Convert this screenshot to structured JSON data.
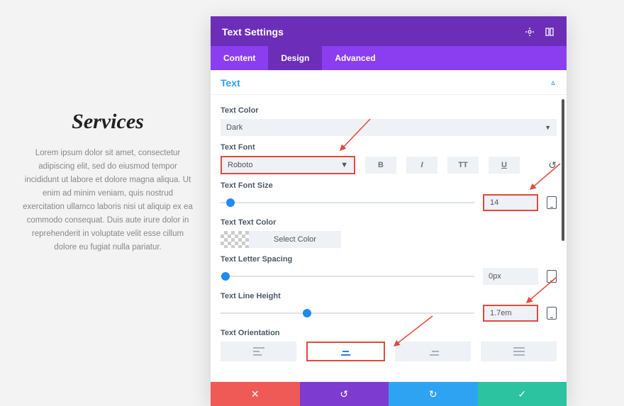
{
  "preview": {
    "heading": "Services",
    "body": "Lorem ipsum dolor sit amet, consectetur adipiscing elit, sed do eiusmod tempor incididunt ut labore et dolore magna aliqua. Ut enim ad minim veniam, quis nostrud exercitation ullamco laboris nisi ut aliquip ex ea commodo consequat. Duis aute irure dolor in reprehenderit in voluptate velit esse cillum dolore eu fugiat nulla pariatur."
  },
  "modal": {
    "title": "Text Settings",
    "tabs": [
      "Content",
      "Design",
      "Advanced"
    ],
    "active_tab": "Design",
    "section": "Text",
    "labels": {
      "text_color": "Text Color",
      "text_font": "Text Font",
      "font_size": "Text Font Size",
      "text_text_color": "Text Text Color",
      "select_color": "Select Color",
      "letter_spacing": "Text Letter Spacing",
      "line_height": "Text Line Height",
      "orientation": "Text Orientation"
    },
    "values": {
      "text_color_option": "Dark",
      "font_option": "Roboto",
      "font_size": "14",
      "letter_spacing": "0px",
      "line_height": "1.7em"
    },
    "style_buttons": {
      "bold": "B",
      "italic": "I",
      "uppercase": "TT",
      "underline": "U"
    }
  }
}
